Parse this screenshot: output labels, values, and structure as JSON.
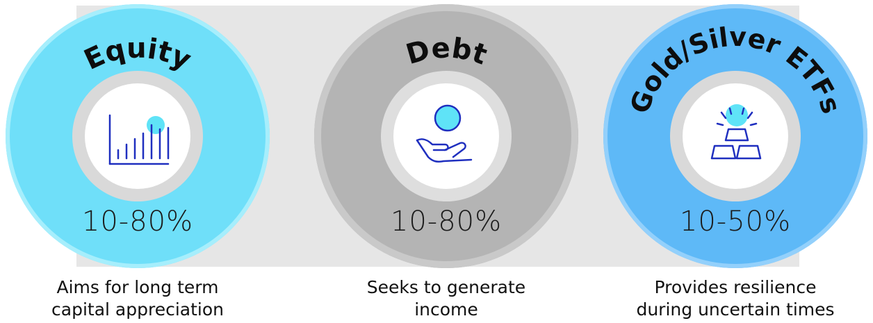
{
  "columns": [
    {
      "title": "Equity",
      "allocation": "10-80%",
      "caption_line1": "Aims for long term",
      "caption_line2": "capital appreciation",
      "icon": "bar-chart-icon",
      "outer_color": "#6fdff9",
      "outer_border": "#a6eefc",
      "inner_ring_color": "#d9d9d9"
    },
    {
      "title": "Debt",
      "allocation": "10-80%",
      "caption_line1": "Seeks to generate",
      "caption_line2": "income",
      "icon": "coin-in-hand-icon",
      "outer_color": "#b4b4b4",
      "outer_border": "#cfcfcf",
      "inner_ring_color": "#dedede"
    },
    {
      "title": "Gold/Silver ETFs",
      "allocation": "10-50%",
      "caption_line1": "Provides resilience",
      "caption_line2": "during uncertain times",
      "icon": "gold-bars-icon",
      "outer_color": "#5eb9f7",
      "outer_border": "#93d0fb",
      "inner_ring_color": "#d9d9d9"
    }
  ],
  "accent_colors": {
    "icon_stroke": "#1f2fbf",
    "icon_highlight": "#5fe3f7"
  }
}
